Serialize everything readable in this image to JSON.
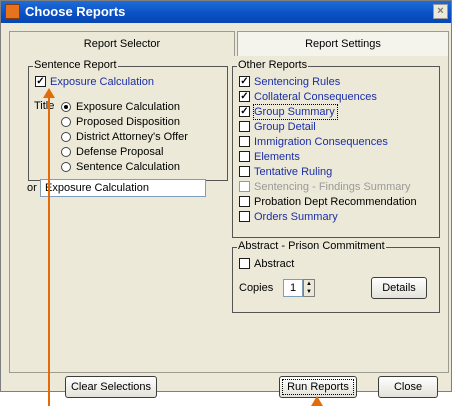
{
  "window": {
    "title": "Choose Reports",
    "close_glyph": "×"
  },
  "tabs": [
    {
      "label": "Report Selector",
      "active": true
    },
    {
      "label": "Report Settings",
      "active": false
    }
  ],
  "sentence_report": {
    "legend": "Sentence Report",
    "checkbox_label": "Exposure Calculation",
    "checked": true,
    "title_label": "Title",
    "options": [
      {
        "label": "Exposure Calculation",
        "selected": true
      },
      {
        "label": "Proposed Disposition",
        "selected": false
      },
      {
        "label": "District Attorney's Offer",
        "selected": false
      },
      {
        "label": "Defense Proposal",
        "selected": false
      },
      {
        "label": "Sentence Calculation",
        "selected": false
      }
    ],
    "or_label": "or",
    "title_value": "Exposure Calculation"
  },
  "other_reports": {
    "legend": "Other Reports",
    "items": [
      {
        "label": "Sentencing Rules",
        "checked": true
      },
      {
        "label": "Collateral Consequences",
        "checked": true
      },
      {
        "label": "Group Summary",
        "checked": true
      },
      {
        "label": "Group Detail",
        "checked": false
      },
      {
        "label": "Immigration Consequences",
        "checked": false
      },
      {
        "label": "Elements",
        "checked": false
      },
      {
        "label": "Tentative Ruling",
        "checked": false
      },
      {
        "label": "Sentencing - Findings Summary",
        "checked": false
      },
      {
        "label": "Probation Dept Recommendation",
        "checked": false
      },
      {
        "label": "Orders Summary",
        "checked": false
      }
    ]
  },
  "abstract": {
    "legend": "Abstract - Prison Commitment",
    "checkbox_label": "Abstract",
    "checked": false,
    "copies_label": "Copies",
    "copies_value": "1",
    "details_label": "Details"
  },
  "buttons": {
    "clear": "Clear Selections",
    "run": "Run Reports",
    "close": "Close"
  },
  "check_glyph": "✓",
  "colors": {
    "accent_arrow": "#e36c09",
    "title_bar": "#0a4fc4",
    "link_text": "#1b2fa7"
  }
}
